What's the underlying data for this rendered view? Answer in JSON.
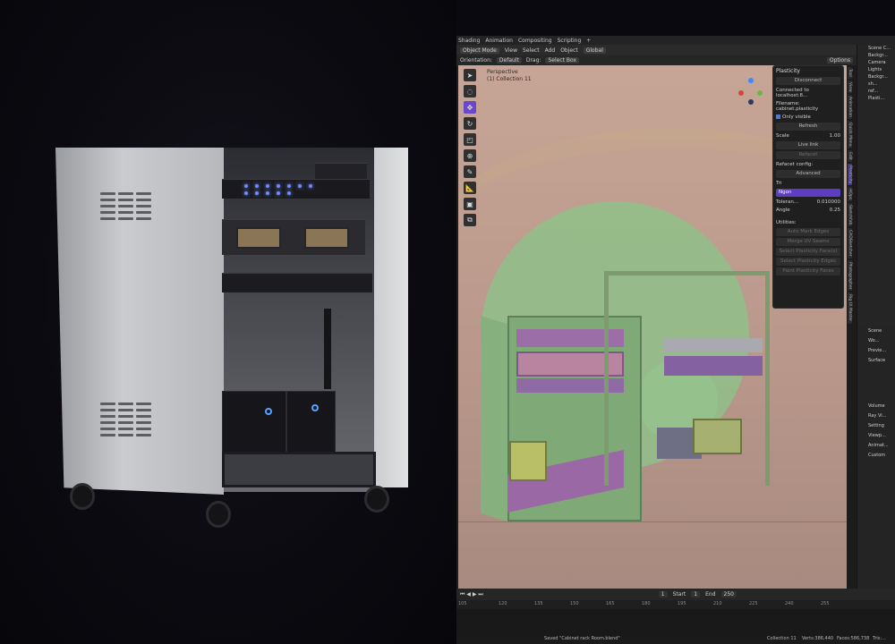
{
  "workspace_tabs": [
    "Shading",
    "Animation",
    "Compositing",
    "Scripting",
    "+"
  ],
  "header": {
    "mode": "Object Mode",
    "menus": [
      "View",
      "Select",
      "Add",
      "Object"
    ],
    "transform": "Global"
  },
  "subheader": {
    "orientation_label": "Orientation:",
    "orientation_value": "Default",
    "drag_label": "Drag:",
    "drag_value": "Select Box",
    "options": "Options"
  },
  "viewport_overlay": {
    "line1": "Perspective",
    "line2": "(1) Collection 11"
  },
  "tools": [
    "cursor",
    "select",
    "move",
    "rotate",
    "scale",
    "transform",
    "annotate",
    "measure",
    "add-cube",
    "extrude"
  ],
  "plasticity": {
    "title": "Plasticity",
    "disconnect": "Disconnect",
    "connected": "Connected to localhost:8...",
    "filename": "Filename: cabinet.plasticity",
    "only_visible": "Only visible",
    "refresh": "Refresh",
    "scale_label": "Scale",
    "scale_value": "1.00",
    "live_link": "Live link",
    "refacet": "Refacet",
    "refacet_config": "Refacet config:",
    "advanced": "Advanced",
    "tri": "Tri",
    "ngon": "Ngon",
    "tolerance_label": "Toleran...",
    "tolerance_value": "0.010000",
    "angle_label": "Angle",
    "angle_value": "0.25",
    "utilities": "Utilities:",
    "util_items": [
      "Auto Mark Edges",
      "Merge UV Seams",
      "Select Plasticity Face(s)",
      "Select Plasticity Edges",
      "Paint Plasticity Faces"
    ]
  },
  "side_tabs": [
    "Tool",
    "View",
    "Animation",
    "Quick Menu",
    "Edit",
    "Plasticity",
    "HOps",
    "Sketchfab",
    "CADSketcher",
    "Photographer",
    "Rig UI Master"
  ],
  "outliner": [
    "Scene C...",
    "Backgr...",
    "Camera",
    "Lights",
    "Backgr...",
    "sh...",
    "ref...",
    "Plasti..."
  ],
  "properties": {
    "scene": "Scene",
    "world": "Wo...",
    "rows": [
      "Previe...",
      "Surface",
      "Volume",
      "Ray Vi...",
      "Setting",
      "Viewp...",
      "Animat...",
      "Custom"
    ]
  },
  "timeline": {
    "current_frame": "1",
    "start_label": "Start",
    "start": "1",
    "end_label": "End",
    "end": "250",
    "ticks": [
      "105",
      "120",
      "135",
      "150",
      "165",
      "180",
      "195",
      "210",
      "225",
      "240",
      "255"
    ]
  },
  "status": {
    "saved": "Saved \"Cabinet rack Room.blend\"",
    "collection": "Collection 11",
    "verts": "Verts:386,440",
    "faces": "Faces:586,738",
    "tris": "Tris:..."
  }
}
